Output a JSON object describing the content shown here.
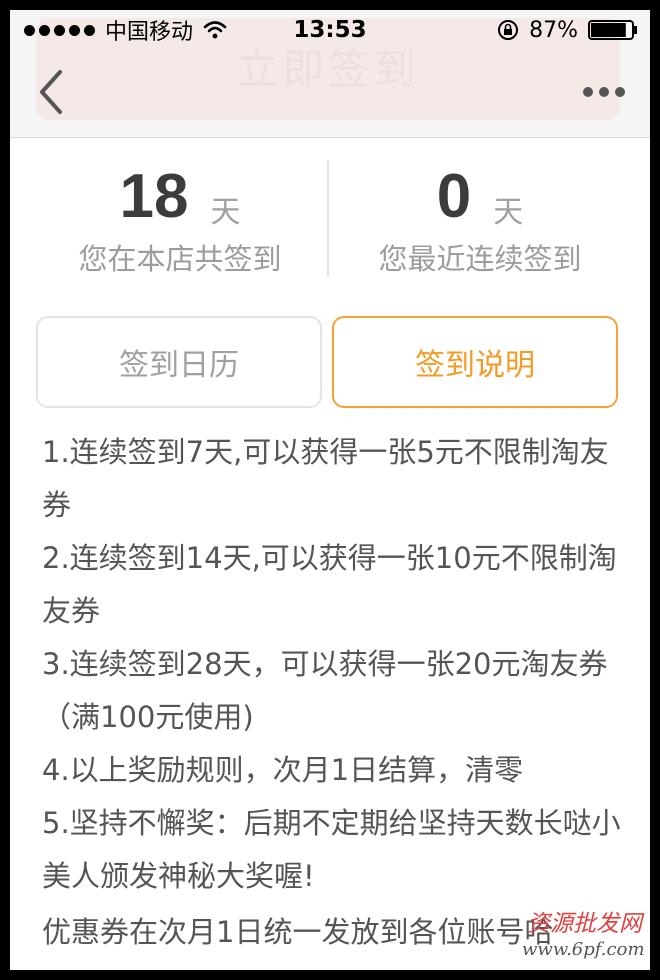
{
  "status_bar": {
    "carrier": "中国移动",
    "time": "13:53",
    "battery": "87%",
    "battery_level": 0.87
  },
  "nav": {
    "banner_text": "立即签到",
    "back_icon": "chevron-left-icon",
    "more_icon": "ellipsis-icon"
  },
  "stats": {
    "total": {
      "value": "18",
      "unit": "天",
      "label": "您在本店共签到"
    },
    "streak": {
      "value": "0",
      "unit": "天",
      "label": "您最近连续签到"
    }
  },
  "tabs": [
    {
      "label": "签到日历",
      "active": false
    },
    {
      "label": "签到说明",
      "active": true
    }
  ],
  "rules": [
    "1.连续签到7天,可以获得一张5元不限制淘友券",
    "2.连续签到14天,可以获得一张10元不限制淘友券",
    "3.连续签到28天，可以获得一张20元淘友券（满100元使用)",
    "4.以上奖励规则，次月1日结算，清零",
    "5.坚持不懈奖：后期不定期给坚持天数长哒小美人颁发神秘大奖喔!"
  ],
  "footnote": "优惠券在次月1日统一发放到各位账号哈",
  "watermark": {
    "top": "资源批发网",
    "bottom": "www.6pf.com"
  },
  "colors": {
    "accent": "#f39b25",
    "text": "#555555",
    "muted": "#9c9c9c"
  }
}
